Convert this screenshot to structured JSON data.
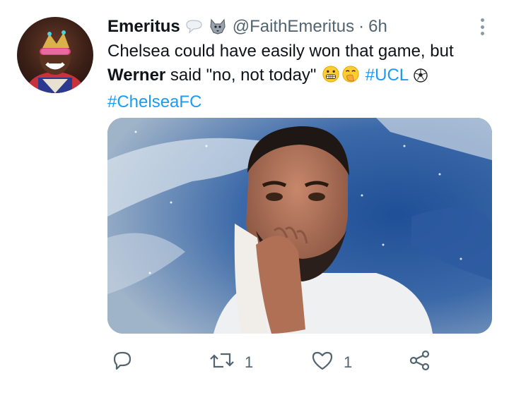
{
  "author": {
    "name": "Emeritus",
    "handle": "@FaithEmeritus",
    "separator": "·",
    "time": "6h",
    "badge_icons": [
      "speech-bubble-icon",
      "wolf-icon"
    ]
  },
  "tweet": {
    "line1": "Chelsea could have easily won that game, but",
    "bold_word": "Werner",
    "line2_rest": " said \"no, not today\"",
    "hashtag1": "#UCL",
    "hashtag2": "#ChelseaFC",
    "emoji_icons": [
      "grimacing-face-icon",
      "face-with-hand-over-mouth-icon",
      "soccer-ball-icon"
    ]
  },
  "actions": {
    "reply_icon": "reply-icon",
    "retweet_icon": "retweet-icon",
    "retweet_count": "1",
    "like_icon": "heart-icon",
    "like_count": "1",
    "share_icon": "share-icon"
  },
  "colors": {
    "link": "#1d9bf0",
    "muted": "#536471",
    "text": "#0f1419"
  }
}
